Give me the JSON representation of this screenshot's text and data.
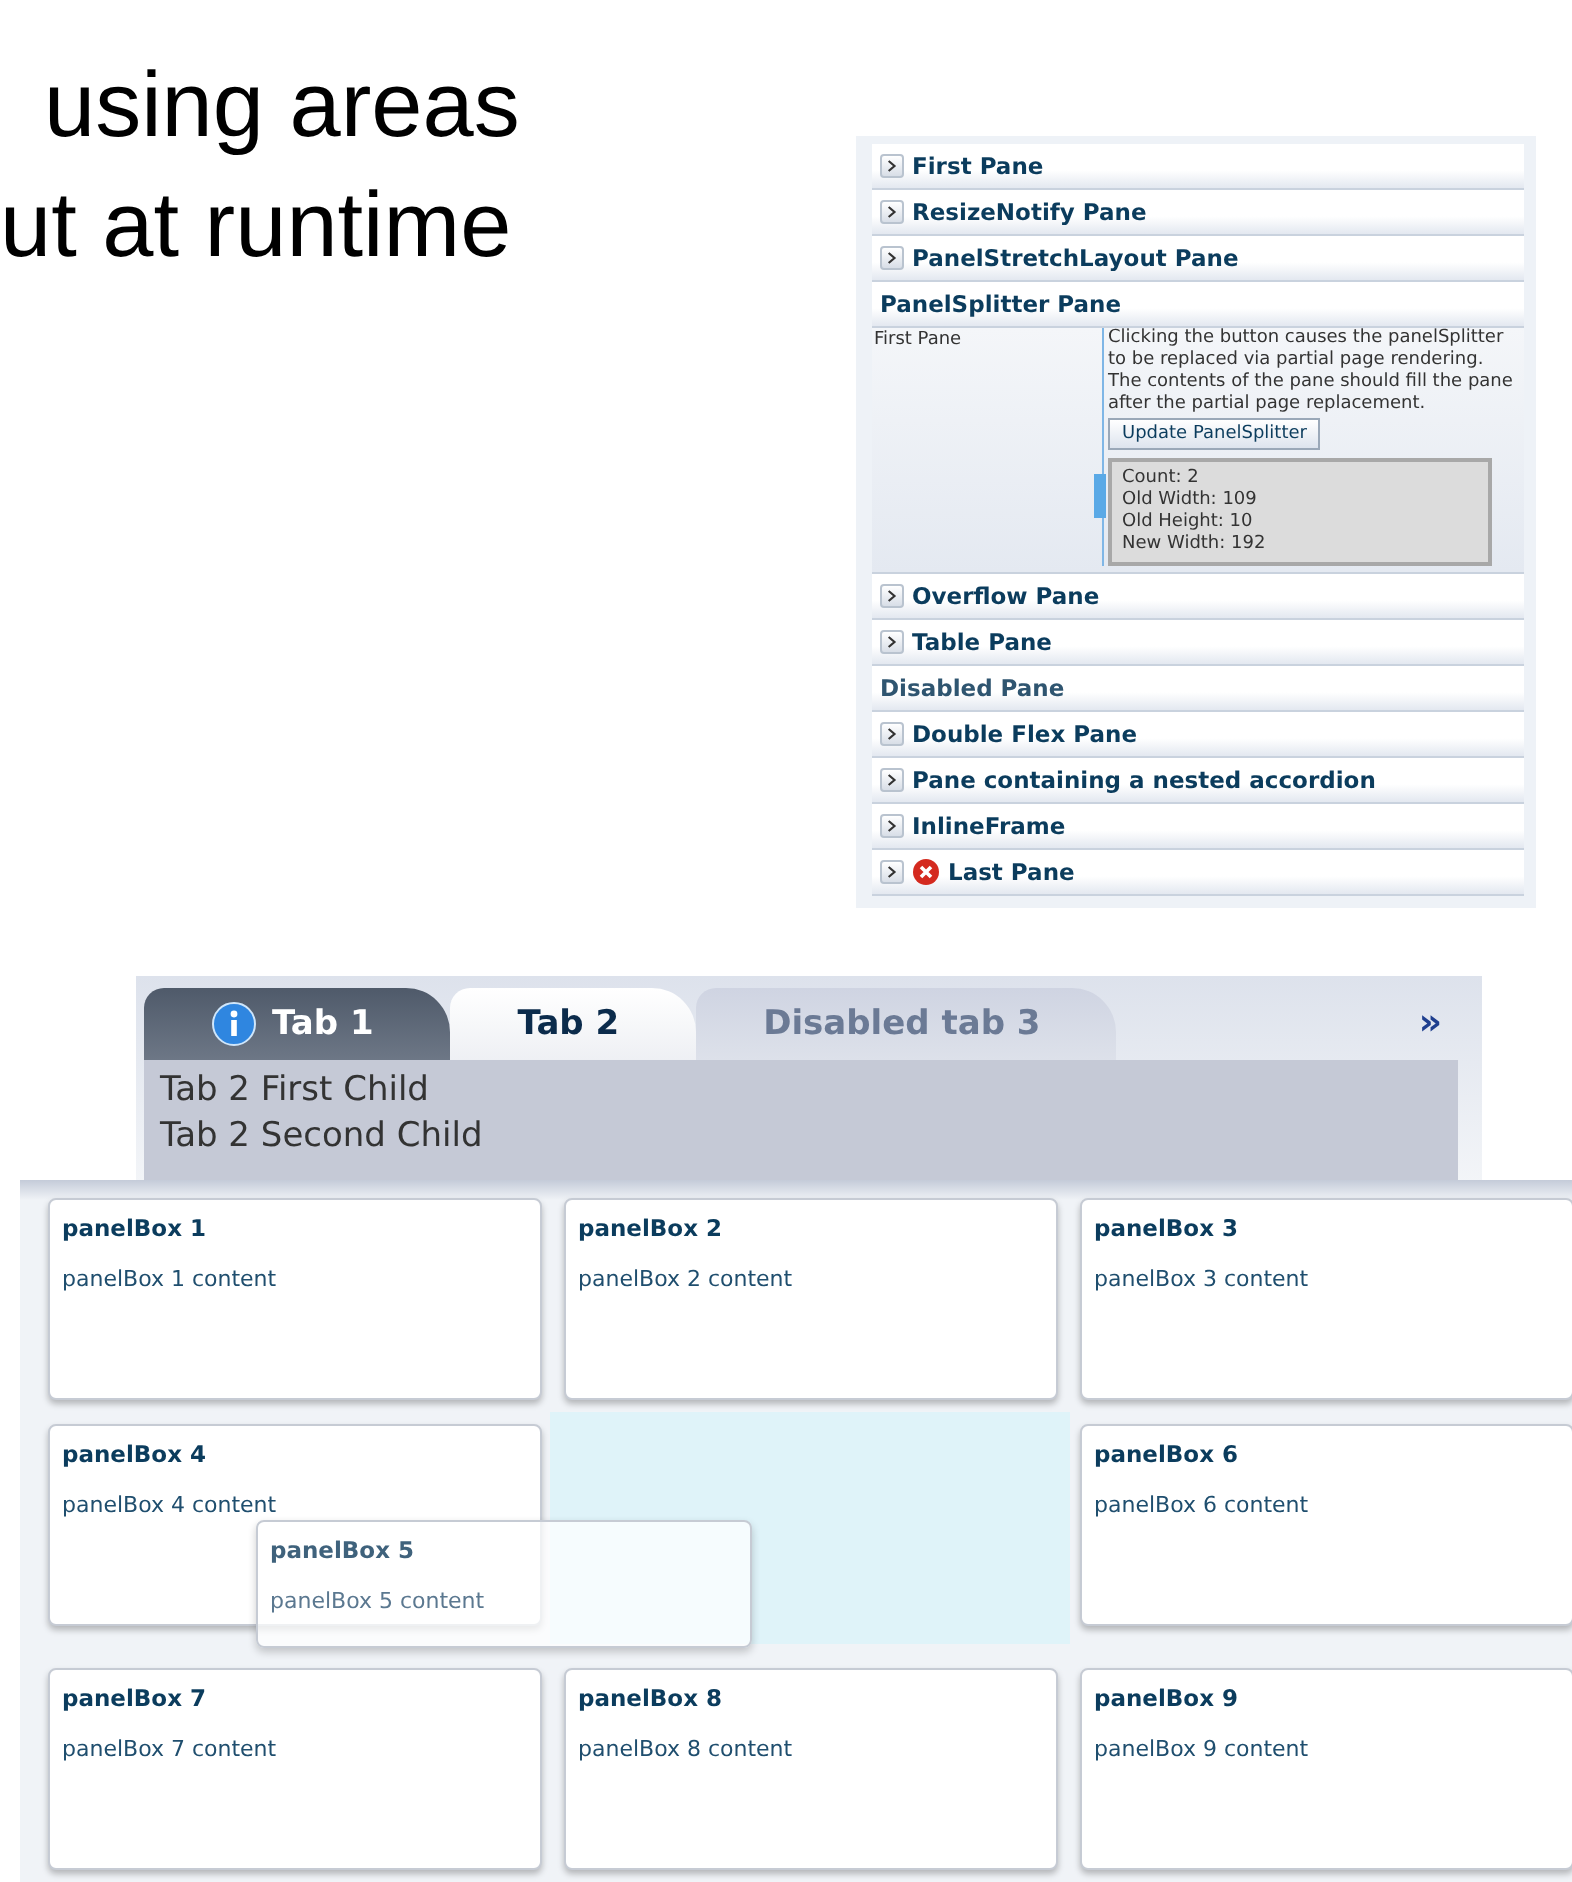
{
  "slide_heading": {
    "lines": [
      "using areas",
      "ut at runtime"
    ]
  },
  "accordion": {
    "panes": [
      {
        "title": "First Pane",
        "expanded": false,
        "disabled": false
      },
      {
        "title": "ResizeNotify Pane",
        "expanded": false,
        "disabled": false
      },
      {
        "title": "PanelStretchLayout Pane",
        "expanded": false,
        "disabled": false
      },
      {
        "title": "PanelSplitter Pane",
        "expanded": true,
        "disabled": false,
        "content": {
          "first_pane_label": "First Pane",
          "description": "Clicking the button causes the panelSplitter to be replaced via partial page rendering. The contents of the pane should fill the pane after the partial page replacement.",
          "button": "Update PanelSplitter",
          "info_lines": [
            "Count: 2",
            "Old Width: 109",
            "Old Height: 10",
            "New Width: 192"
          ]
        }
      },
      {
        "title": "Overflow Pane",
        "expanded": false,
        "disabled": false
      },
      {
        "title": "Table Pane",
        "expanded": false,
        "disabled": false
      },
      {
        "title": "Disabled Pane",
        "expanded": false,
        "disabled": true
      },
      {
        "title": "Double Flex Pane",
        "expanded": false,
        "disabled": false
      },
      {
        "title": "Pane containing a nested accordion",
        "expanded": false,
        "disabled": false
      },
      {
        "title": "InlineFrame",
        "expanded": false,
        "disabled": false
      },
      {
        "title": "Last Pane",
        "expanded": false,
        "disabled": false,
        "kind": "error"
      }
    ]
  },
  "tab_panel": {
    "tabs": [
      {
        "label": "Tab 1",
        "selected": false,
        "disabled": false,
        "kind": "info"
      },
      {
        "label": "Tab 2",
        "selected": true,
        "disabled": false
      },
      {
        "label": "Disabled tab 3",
        "selected": false,
        "disabled": true
      }
    ],
    "overflow": "»",
    "children": [
      "Tab 2 First Child",
      "Tab 2 Second Child"
    ]
  },
  "dashboard": {
    "panel_boxes": [
      {
        "title": "panelBox 1",
        "content": "panelBox 1 content",
        "dragging": false
      },
      {
        "title": "panelBox 2",
        "content": "panelBox 2 content",
        "dragging": false
      },
      {
        "title": "panelBox 3",
        "content": "panelBox 3 content",
        "dragging": false
      },
      {
        "title": "panelBox 4",
        "content": "panelBox 4 content",
        "dragging": false
      },
      {
        "title": "panelBox 5",
        "content": "panelBox 5 content",
        "dragging": true
      },
      {
        "title": "panelBox 6",
        "content": "panelBox 6 content",
        "dragging": false
      },
      {
        "title": "panelBox 7",
        "content": "panelBox 7 content",
        "dragging": false
      },
      {
        "title": "panelBox 8",
        "content": "panelBox 8 content",
        "dragging": false
      },
      {
        "title": "panelBox 9",
        "content": "panelBox 9 content",
        "dragging": false
      }
    ]
  }
}
